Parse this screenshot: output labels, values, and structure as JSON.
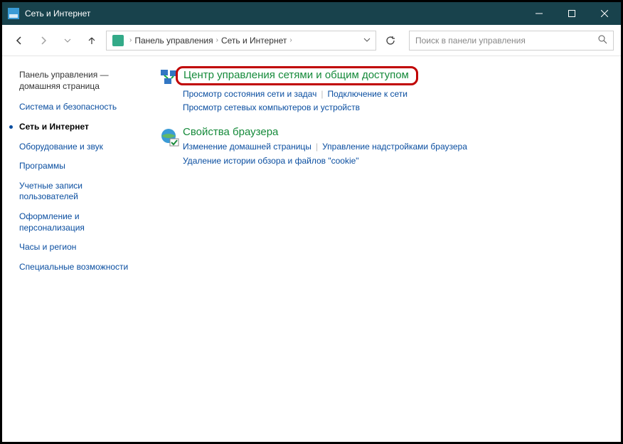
{
  "window": {
    "title": "Сеть и Интернет"
  },
  "breadcrumbs": {
    "root": "Панель управления",
    "here": "Сеть и Интернет"
  },
  "search": {
    "placeholder": "Поиск в панели управления"
  },
  "sidebar": {
    "home": "Панель управления — домашняя страница",
    "items": [
      "Система и безопасность",
      "Сеть и Интернет",
      "Оборудование и звук",
      "Программы",
      "Учетные записи пользователей",
      "Оформление и персонализация",
      "Часы и регион",
      "Специальные возможности"
    ]
  },
  "main": {
    "sec1": {
      "title": "Центр управления сетями и общим доступом",
      "l1": "Просмотр состояния сети и задач",
      "l2": "Подключение к сети",
      "l3": "Просмотр сетевых компьютеров и устройств"
    },
    "sec2": {
      "title": "Свойства браузера",
      "l1": "Изменение домашней страницы",
      "l2": "Управление надстройками браузера",
      "l3": "Удаление истории обзора и файлов \"cookie\""
    }
  }
}
